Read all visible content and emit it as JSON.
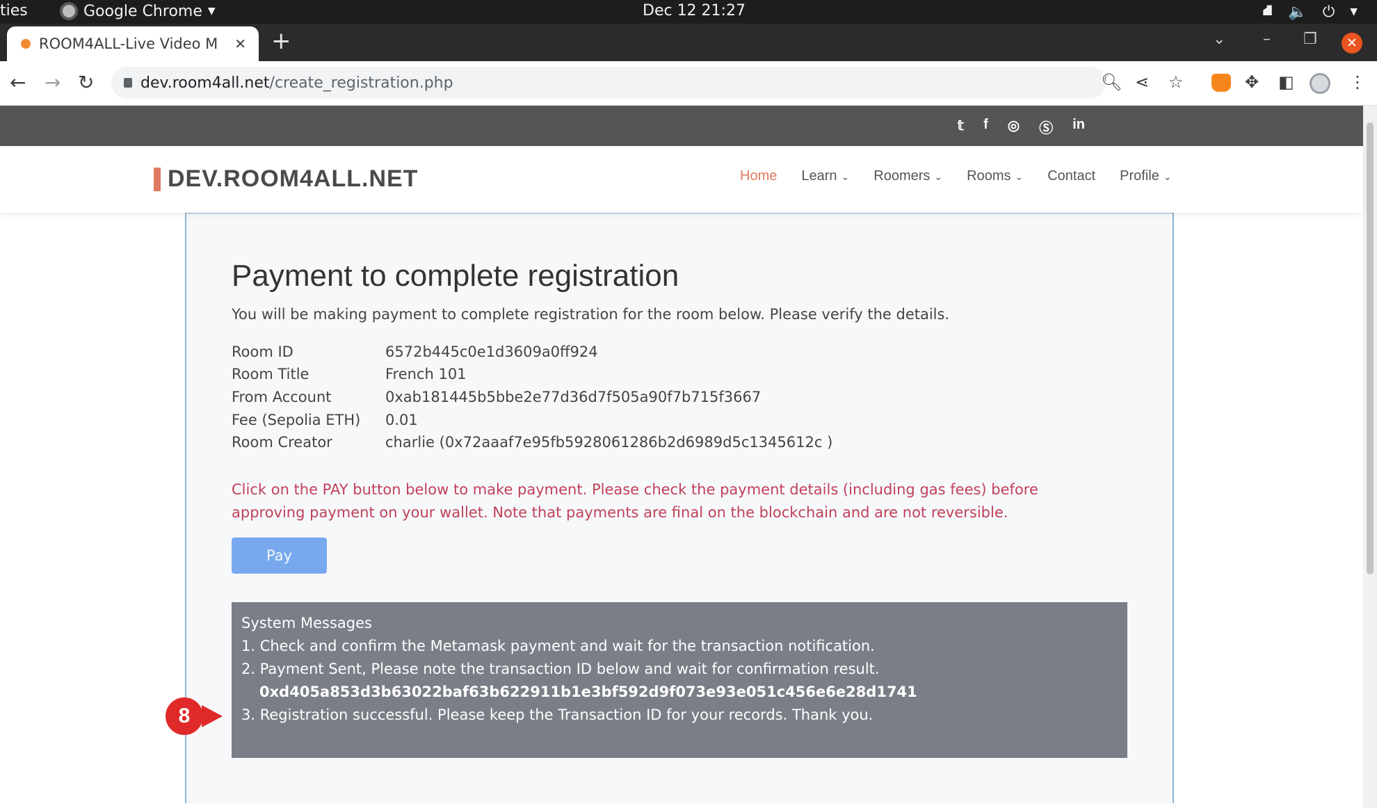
{
  "os": {
    "activities": "ties",
    "app_name": "Google Chrome",
    "clock": "Dec 12  21:27"
  },
  "browser": {
    "tab_title": "ROOM4ALL-Live Video M",
    "url_host": "dev.room4all.net",
    "url_path": "/create_registration.php"
  },
  "site": {
    "logo": "DEV.ROOM4ALL.NET",
    "social": [
      "twitter-icon",
      "facebook-icon",
      "instagram-icon",
      "skype-icon",
      "linkedin-icon"
    ],
    "nav": {
      "home": "Home",
      "learn": "Learn",
      "roomers": "Roomers",
      "rooms": "Rooms",
      "contact": "Contact",
      "profile": "Profile"
    }
  },
  "main": {
    "heading": "Payment to complete registration",
    "intro": "You will be making payment to complete registration for the room below. Please verify the details.",
    "details": [
      {
        "label": "Room ID",
        "value": "6572b445c0e1d3609a0ff924"
      },
      {
        "label": "Room Title",
        "value": "French 101"
      },
      {
        "label": "From Account",
        "value": "0xab181445b5bbe2e77d36d7f505a90f7b715f3667"
      },
      {
        "label": "Fee (Sepolia ETH)",
        "value": "0.01"
      },
      {
        "label": "Room Creator",
        "value": "charlie (0x72aaaf7e95fb5928061286b2d6989d5c1345612c )"
      }
    ],
    "warning": "Click on the PAY button below to make payment. Please check the payment details (including gas fees) before approving payment on your wallet. Note that payments are final on the blockchain and are not reversible.",
    "pay_label": "Pay",
    "messages": {
      "title": "System Messages",
      "line1": "1. Check and confirm the Metamask payment and wait for the transaction notification.",
      "line2": "2. Payment Sent, Please note the transaction ID below and wait for confirmation result.",
      "tx_id": "0xd405a853d3b63022baf63b622911b1e3bf592d9f073e93e051c456e6e28d1741",
      "line3": "3. Registration successful. Please keep the Transaction ID for your records. Thank you."
    }
  },
  "annotation": {
    "step_number": "8"
  },
  "colors": {
    "accent": "#e07a5f",
    "warning_text": "#c0415a",
    "pay_button": "#78a9ee",
    "message_box": "#7a7e87"
  }
}
